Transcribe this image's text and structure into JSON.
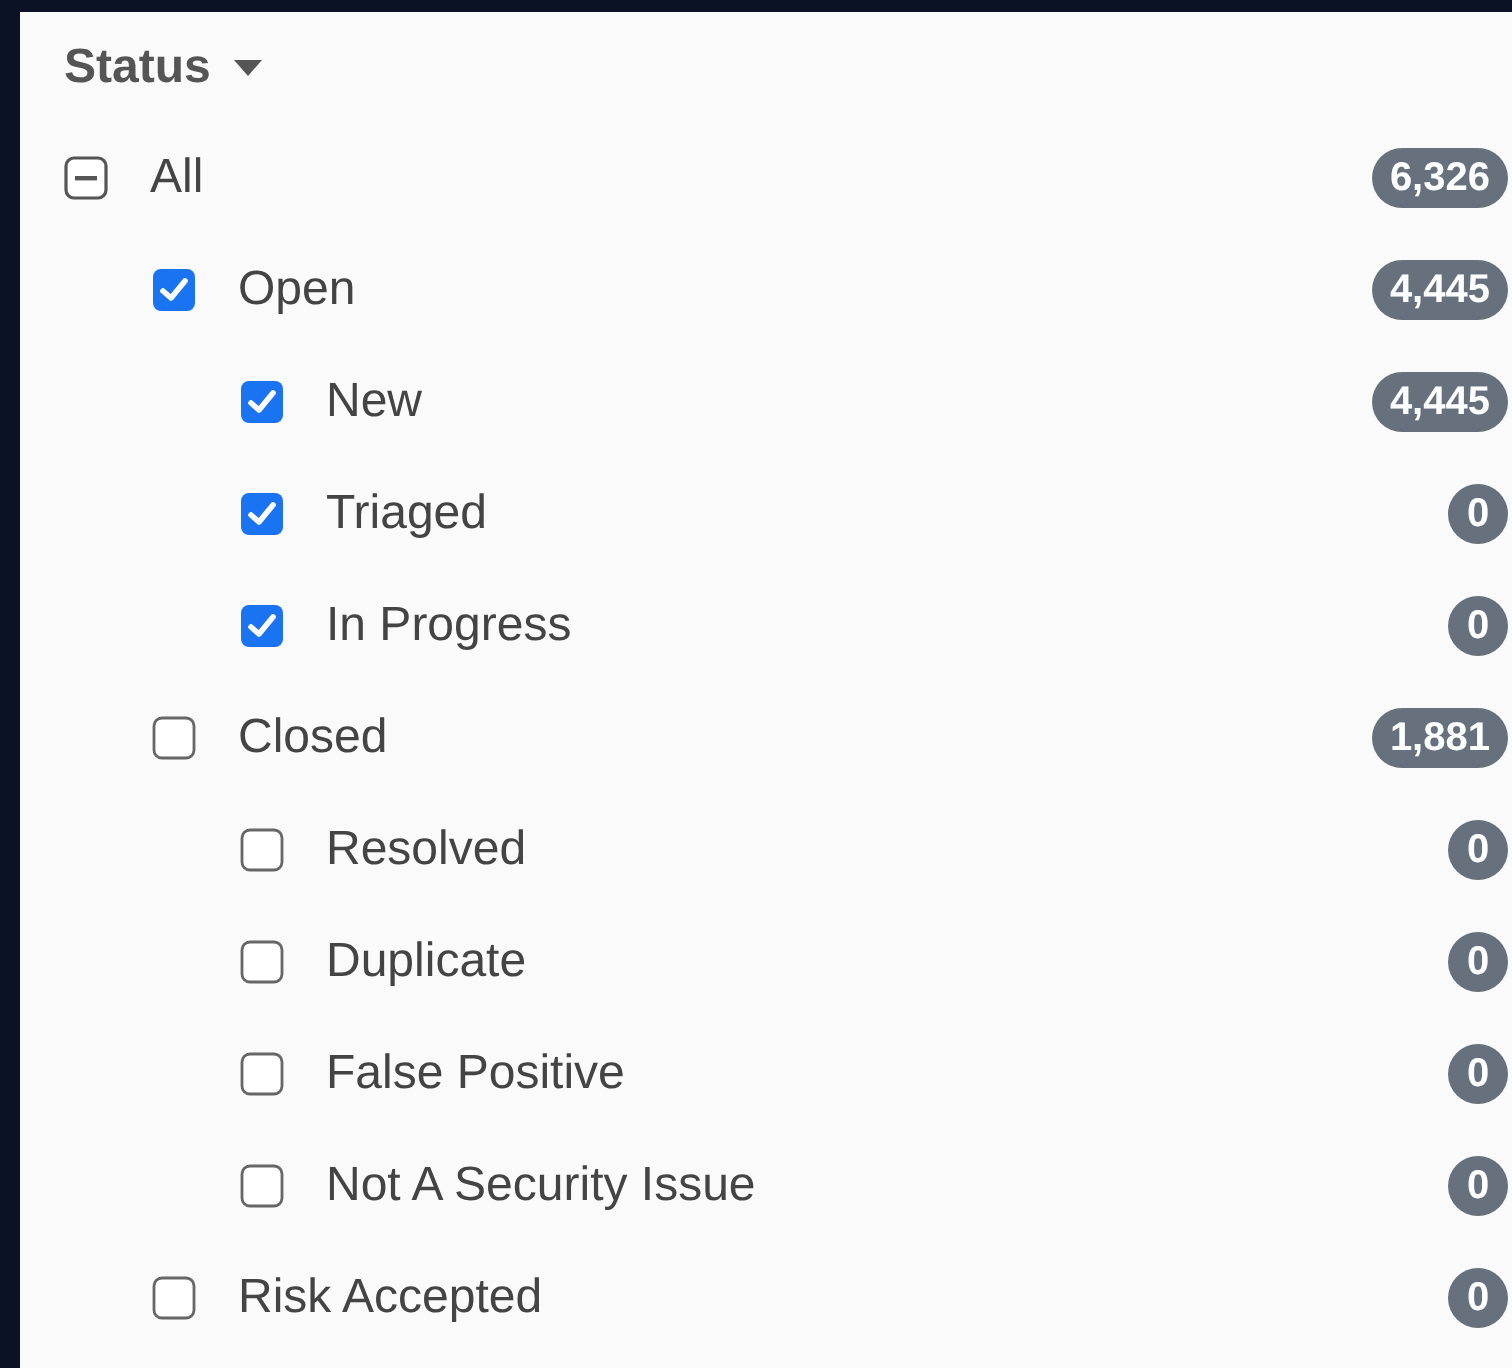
{
  "filter": {
    "title": "Status",
    "items": [
      {
        "label": "All",
        "checked": false,
        "indeterminate": true,
        "count": "6,326",
        "children": [
          {
            "label": "Open",
            "checked": true,
            "indeterminate": false,
            "count": "4,445",
            "children": [
              {
                "label": "New",
                "checked": true,
                "indeterminate": false,
                "count": "4,445"
              },
              {
                "label": "Triaged",
                "checked": true,
                "indeterminate": false,
                "count": "0"
              },
              {
                "label": "In Progress",
                "checked": true,
                "indeterminate": false,
                "count": "0"
              }
            ]
          },
          {
            "label": "Closed",
            "checked": false,
            "indeterminate": false,
            "count": "1,881",
            "children": [
              {
                "label": "Resolved",
                "checked": false,
                "indeterminate": false,
                "count": "0"
              },
              {
                "label": "Duplicate",
                "checked": false,
                "indeterminate": false,
                "count": "0"
              },
              {
                "label": "False Positive",
                "checked": false,
                "indeterminate": false,
                "count": "0"
              },
              {
                "label": "Not A Security Issue",
                "checked": false,
                "indeterminate": false,
                "count": "0"
              }
            ]
          },
          {
            "label": "Risk Accepted",
            "checked": false,
            "indeterminate": false,
            "count": "0"
          }
        ]
      }
    ]
  }
}
